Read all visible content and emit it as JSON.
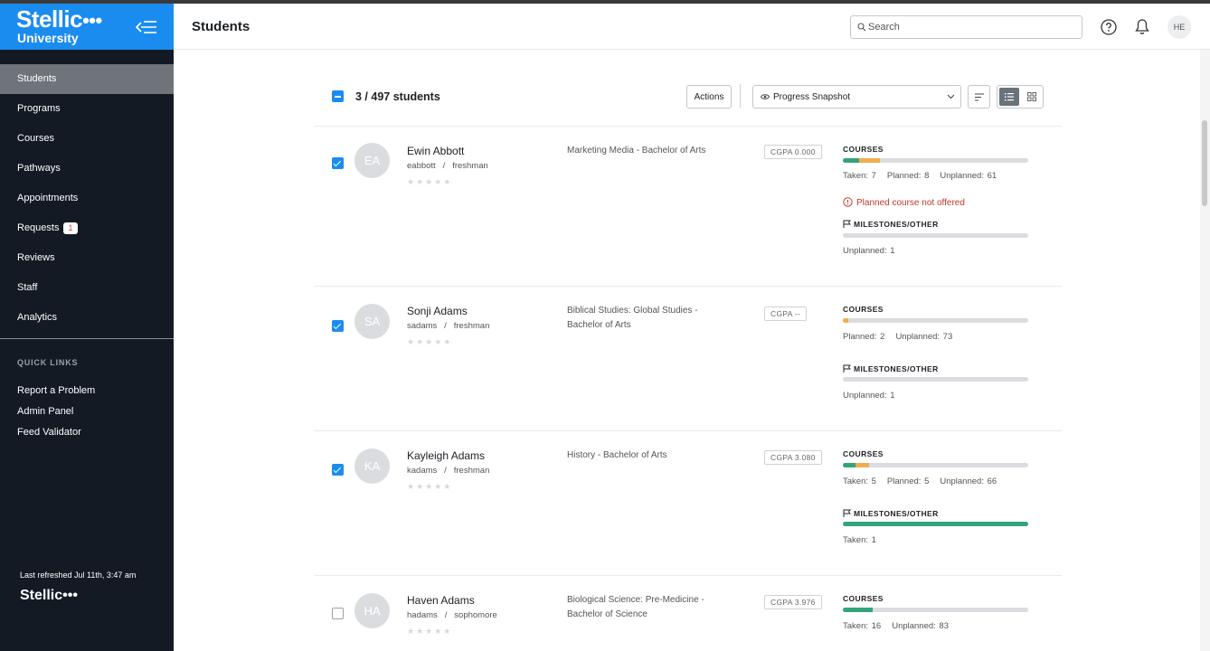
{
  "brand": {
    "name": "Stellic",
    "dots": "•••",
    "subtitle": "University"
  },
  "sidebar": {
    "items": [
      {
        "label": "Students",
        "active": true
      },
      {
        "label": "Programs"
      },
      {
        "label": "Courses"
      },
      {
        "label": "Pathways"
      },
      {
        "label": "Appointments"
      },
      {
        "label": "Requests",
        "badge": "1"
      },
      {
        "label": "Reviews"
      },
      {
        "label": "Staff"
      },
      {
        "label": "Analytics"
      }
    ],
    "quick_links_title": "QUICK LINKS",
    "quick_links": [
      "Report a Problem",
      "Admin Panel",
      "Feed Validator"
    ],
    "refreshed": "Last refreshed Jul 11th, 3:47 am",
    "footer_logo": "Stellic•••"
  },
  "header": {
    "title": "Students",
    "search_placeholder": "Search",
    "user_initials": "HE"
  },
  "list": {
    "count": "3 / 497 students",
    "actions_label": "Actions",
    "view_label": "Progress Snapshot",
    "students": [
      {
        "initials": "EA",
        "name": "Ewin Abbott",
        "username": "eabbott",
        "year": "freshman",
        "program": "Marketing Media - Bachelor of Arts",
        "cgpa": "CGPA 0.000",
        "checked": true,
        "courses_label": "COURSES",
        "courses_taken": 0.09,
        "courses_planned": 0.11,
        "courses_stats": [
          "Taken: 7",
          "Planned: 8",
          "Unplanned: 61"
        ],
        "warning": "Planned course not offered",
        "milestones_label": "MILESTONES/OTHER",
        "milestones_taken": 0,
        "milestones_stats": [
          "Unplanned: 1"
        ]
      },
      {
        "initials": "SA",
        "name": "Sonji Adams",
        "username": "sadams",
        "year": "freshman",
        "program": "Biblical Studies: Global Studies - Bachelor of Arts",
        "cgpa": "CGPA --",
        "checked": true,
        "courses_label": "COURSES",
        "courses_taken": 0,
        "courses_planned": 0.03,
        "courses_stats": [
          "Planned: 2",
          "Unplanned: 73"
        ],
        "milestones_label": "MILESTONES/OTHER",
        "milestones_taken": 0,
        "milestones_stats": [
          "Unplanned: 1"
        ]
      },
      {
        "initials": "KA",
        "name": "Kayleigh Adams",
        "username": "kadams",
        "year": "freshman",
        "program": "History - Bachelor of Arts",
        "cgpa": "CGPA 3.080",
        "checked": true,
        "courses_label": "COURSES",
        "courses_taken": 0.07,
        "courses_planned": 0.07,
        "courses_stats": [
          "Taken: 5",
          "Planned: 5",
          "Unplanned: 66"
        ],
        "milestones_label": "MILESTONES/OTHER",
        "milestones_taken": 1,
        "milestones_stats": [
          "Taken: 1"
        ]
      },
      {
        "initials": "HA",
        "name": "Haven Adams",
        "username": "hadams",
        "year": "sophomore",
        "program": "Biological Science: Pre-Medicine - Bachelor of Science",
        "cgpa": "CGPA 3.976",
        "checked": false,
        "courses_label": "COURSES",
        "courses_taken": 0.16,
        "courses_planned": 0,
        "courses_stats": [
          "Taken: 16",
          "Unplanned: 83"
        ]
      }
    ]
  },
  "colors": {
    "brand": "#1a8cf0",
    "sidebar": "#131a24",
    "taken": "#33a47a",
    "planned": "#f0ad4e",
    "warning": "#c0392b"
  }
}
